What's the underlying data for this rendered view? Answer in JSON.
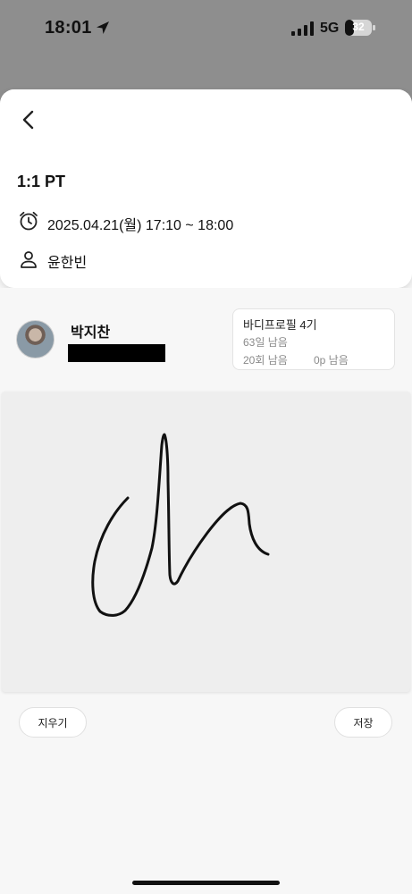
{
  "status_bar": {
    "time": "18:01",
    "network": "5G",
    "battery": "32",
    "battery_level": 0.32
  },
  "session": {
    "title": "1:1 PT",
    "datetime": "2025.04.21(월) 17:10 ~ 18:00",
    "trainer": "윤한빈",
    "icons": {
      "back": "chevron-left-icon",
      "time": "alarm-clock-icon",
      "person": "person-icon"
    }
  },
  "member": {
    "name": "박지찬"
  },
  "package": {
    "name": "바디프로필 4기",
    "days_left": "63일 남음",
    "sessions_left": "20회 남음",
    "points_left": "0p 남음"
  },
  "actions": {
    "clear_label": "지우기",
    "save_label": "저장"
  },
  "colors": {
    "dim_overlay": "#8e8e8e",
    "pad_background": "#eeeeee"
  }
}
